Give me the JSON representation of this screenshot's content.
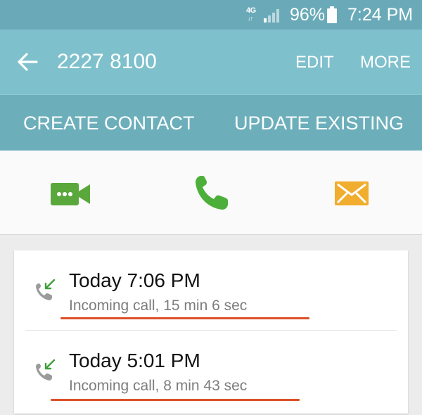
{
  "status_bar": {
    "network_type": "4G",
    "battery_percent": "96%",
    "time": "7:24 PM",
    "icons": [
      "network-4g-icon",
      "signal-icon",
      "battery-icon"
    ]
  },
  "header": {
    "title": "2227 8100",
    "edit_label": "EDIT",
    "more_label": "MORE"
  },
  "contact_actions": {
    "create_label": "CREATE CONTACT",
    "update_label": "UPDATE EXISTING"
  },
  "quick_actions": [
    {
      "icon": "video-call-icon",
      "color": "#5aa83c"
    },
    {
      "icon": "phone-icon",
      "color": "#4caf3a"
    },
    {
      "icon": "message-icon",
      "color": "#f0ad2e"
    }
  ],
  "call_log": [
    {
      "when": "Today 7:06 PM",
      "detail": "Incoming call, 15 min 6 sec",
      "icon": "incoming-call-icon"
    },
    {
      "when": "Today 5:01 PM",
      "detail": "Incoming call, 8 min 43 sec",
      "icon": "incoming-call-icon"
    }
  ],
  "colors": {
    "status_bar": "#6aaab8",
    "action_bar": "#7ec0cc",
    "contact_bar": "#6cafbb",
    "annotation_underline": "#dc5028"
  }
}
